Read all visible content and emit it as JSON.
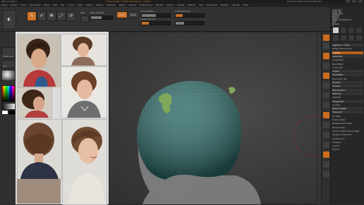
{
  "titlebar": {
    "title": "ZBrush 2019.1",
    "info": "Active Points: 77,836  Total Points: 1.48 Mil",
    "right": "QuickSave  Menus  DefaultZScript"
  },
  "menubar": [
    "Alpha",
    "Brush",
    "Color",
    "Document",
    "Draw",
    "Edit",
    "File",
    "Layer",
    "Light",
    "Macro",
    "Marker",
    "Material",
    "Movie",
    "Picture",
    "Preferences",
    "Render",
    "Stencil",
    "Stroke",
    "Texture",
    "Tool",
    "Transform",
    "Zplugin",
    "Zscript",
    "Help"
  ],
  "toolbar": {
    "buttons": [
      "Edit",
      "Draw",
      "Move",
      "Scale",
      "Rotate"
    ],
    "rgb_label": "Rgb",
    "rgb_intensity_label": "Rgb Intensity",
    "zadd_label": "Zadd",
    "zsub_label": "Zsub",
    "focal_label": "Focal Shift 0",
    "drawsize_label": "Draw Size 24",
    "zintensity_label": "Z Intensity 25",
    "drawsize": 0.25,
    "zintensity": 0.25,
    "focal": 0.5
  },
  "leftcol": {
    "brush_label": "ClayBuildup",
    "stroke_label": "Dots",
    "alpha_label": "Alpha Off",
    "texture_label": "Texture Off",
    "material_label": "SkinShade4",
    "gradient_label": "Gradient",
    "switch_label": "SwitchColor"
  },
  "tray": {
    "rows": [
      "Load Tool",
      "Save As",
      "Copy Tool",
      "Paste Tool",
      "Import",
      "Export",
      "Clone",
      "Make PolyMesh3D",
      "GoZ",
      "All",
      "Visible",
      "R",
      "Lightbox > Tools",
      "PM3D_Sphere3D_1",
      "Subtool",
      "Geometry",
      "ArrayMesh",
      "NanoMesh",
      "Thick Skin",
      "Layers",
      "FiberMesh",
      "Geometry HD",
      "Preview",
      "Surface",
      "Deformation",
      "Masking",
      "Visibility",
      "Polygroups",
      "Contact",
      "Morph Target",
      "Polypaint",
      "UV Map",
      "Texture Map",
      "Displacement Map",
      "Normal Map",
      "Vector Displacement Map",
      "Display Properties",
      "Unified Skin",
      "Initialize",
      "Import",
      "Export"
    ],
    "dynamic_label": "Dynamic Subdiv",
    "subtool_label": "Subtool"
  },
  "icons": {
    "edit": "edit-icon",
    "draw": "brush-icon",
    "move": "move-icon",
    "scale": "scale-icon",
    "rotate": "rotate-icon"
  },
  "colors": {
    "accent": "#d0752a",
    "mesh": "#2f6e6c",
    "moss": "#7fa85a"
  }
}
